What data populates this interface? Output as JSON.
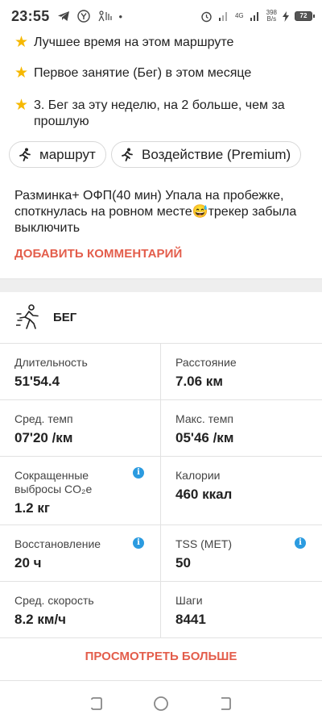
{
  "status_bar": {
    "time": "23:55",
    "net_speed": "398",
    "net_unit": "B/s",
    "net_type": "4G",
    "battery": "72"
  },
  "achievements": [
    {
      "text": "Лучшее время на этом маршруте"
    },
    {
      "text": "Первое занятие (Бег) в этом месяце"
    },
    {
      "text": "3. Бег за эту неделю, на 2 больше, чем за прошлую"
    }
  ],
  "chips": {
    "route": "маршрут",
    "impact": "Воздействие (Premium)"
  },
  "comment": "Разминка+ ОФП(40 мин) Упала на пробежке, споткнулась на ровном месте😅трекер забыла выключить",
  "add_comment": "ДОБАВИТЬ КОММЕНТАРИЙ",
  "sport": "БЕГ",
  "stats": {
    "duration_label": "Длительность",
    "duration_value": "51'54.4",
    "distance_label": "Расстояние",
    "distance_value": "7.06 км",
    "avg_pace_label": "Сред. темп",
    "avg_pace_value": "07'20 /км",
    "max_pace_label": "Макс. темп",
    "max_pace_value": "05'46 /км",
    "co2_label_1": "Сокращенные",
    "co2_label_2": "выбросы CO₂e",
    "co2_value": "1.2 кг",
    "calories_label": "Калории",
    "calories_value": "460 ккал",
    "recovery_label": "Восстановление",
    "recovery_value": "20 ч",
    "tss_label": "TSS (MET)",
    "tss_value": "50",
    "avg_speed_label": "Сред. скорость",
    "avg_speed_value": "8.2 км/ч",
    "steps_label": "Шаги",
    "steps_value": "8441"
  },
  "view_more": "ПРОСМОТРЕТЬ БОЛЬШЕ",
  "colors": {
    "accent": "#e35d4b",
    "info": "#2b9be0",
    "star": "#f6b800"
  }
}
